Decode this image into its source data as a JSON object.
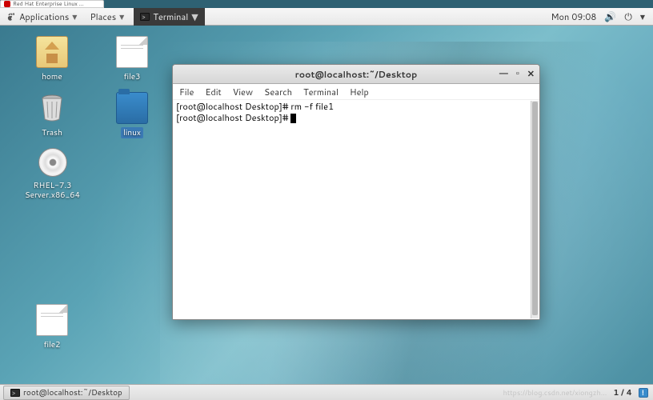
{
  "browser_tab": {
    "title": "Red Hat Enterprise Linux ..."
  },
  "panel": {
    "applications": "Applications",
    "places": "Places",
    "app": "Terminal",
    "clock": "Mon 09:08"
  },
  "desktop": {
    "home": "home",
    "trash": "Trash",
    "rhel": "RHEL-7.3 Server.x86_64",
    "file2": "file2",
    "file3": "file3",
    "linux": "linux"
  },
  "terminal": {
    "title": "root@localhost:~/Desktop",
    "menus": {
      "file": "File",
      "edit": "Edit",
      "view": "View",
      "search": "Search",
      "terminal": "Terminal",
      "help": "Help"
    },
    "line1_prompt": "[root@localhost Desktop]#",
    "line1_cmd": " rm -f file1",
    "line2_prompt": "[root@localhost Desktop]#",
    "line2_cmd": " "
  },
  "bottom": {
    "task": "root@localhost:~/Desktop",
    "watermark": "https://blog.csdn.net/xiongzh...",
    "workspace": "1 / 4"
  }
}
